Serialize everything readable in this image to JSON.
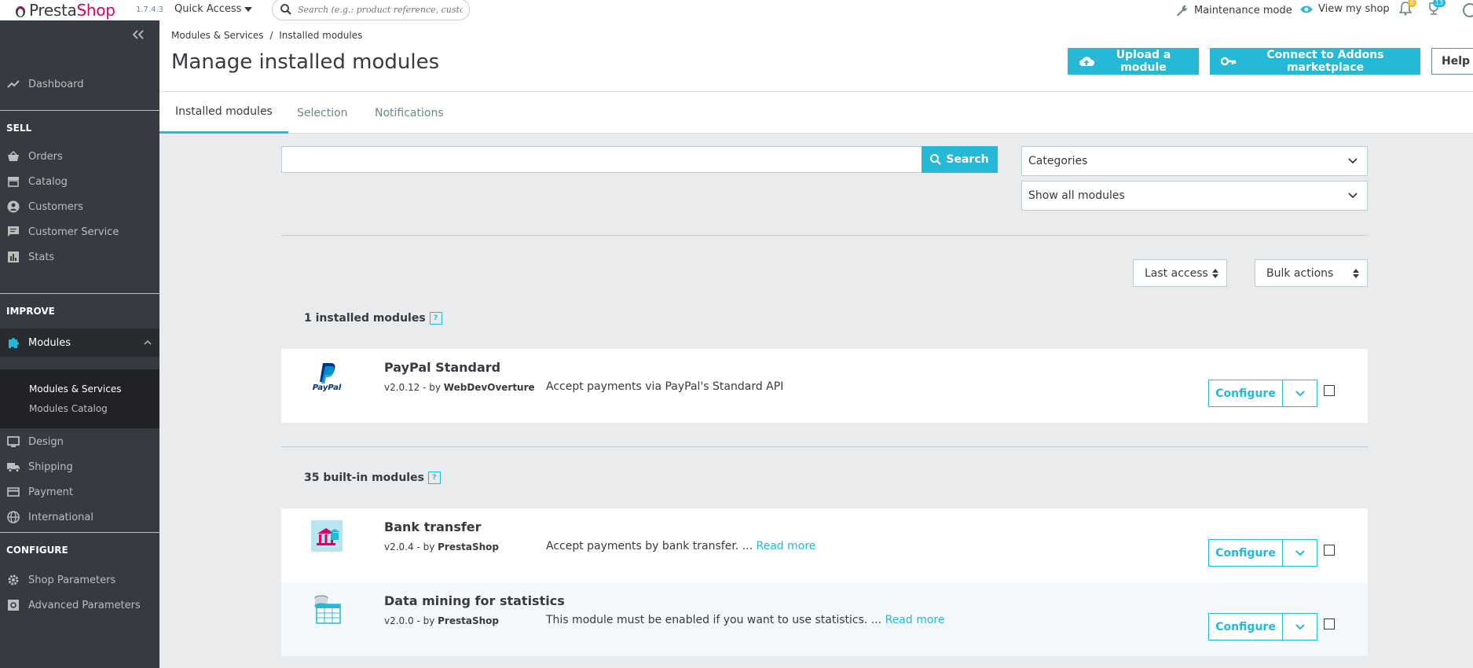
{
  "header": {
    "brand_prefix": "Presta",
    "brand_suffix": "Shop",
    "version": "1.7.4.3",
    "quick_access": "Quick Access",
    "search_placeholder": "Search (e.g.: product reference, custome",
    "maintenance": "Maintenance mode",
    "view_shop": "View my shop",
    "notif_count_1": "6",
    "notif_count_2": "13",
    "accent": "#25b9d7",
    "brand_color": "#df0067"
  },
  "sidebar": {
    "dashboard": "Dashboard",
    "sell": "SELL",
    "orders": "Orders",
    "catalog": "Catalog",
    "customers": "Customers",
    "customer_service": "Customer Service",
    "stats": "Stats",
    "improve": "IMPROVE",
    "modules": "Modules",
    "modules_services": "Modules & Services",
    "modules_catalog": "Modules Catalog",
    "design": "Design",
    "shipping": "Shipping",
    "payment": "Payment",
    "international": "International",
    "configure": "CONFIGURE",
    "shop_parameters": "Shop Parameters",
    "advanced_parameters": "Advanced Parameters"
  },
  "page": {
    "breadcrumb_parent": "Modules & Services",
    "breadcrumb_sep": "/",
    "breadcrumb_current": "Installed modules",
    "title": "Manage installed modules",
    "upload_btn": "Upload a module",
    "connect_btn": "Connect to Addons marketplace",
    "help_btn": "Help"
  },
  "tabs": {
    "installed": "Installed modules",
    "selection": "Selection",
    "notifications": "Notifications"
  },
  "filters": {
    "search_btn": "Search",
    "categories": "Categories",
    "status": "Show all modules",
    "sort": "Last access",
    "bulk": "Bulk actions"
  },
  "sections": {
    "installed_count": "1 installed modules",
    "builtin_count": "35 built-in modules",
    "help_mark": "?"
  },
  "modules": {
    "paypal": {
      "name": "PayPal Standard",
      "version": "v2.0.12 - by",
      "author": "WebDevOverture",
      "description": "Accept payments via PayPal's Standard API",
      "logo_text": "PayPal"
    },
    "bank": {
      "name": "Bank transfer",
      "version": "v2.0.4 - by",
      "author": "PrestaShop",
      "description": "Accept payments by bank transfer. ...",
      "read_more": "Read more"
    },
    "datamining": {
      "name": "Data mining for statistics",
      "version": "v2.0.0 - by",
      "author": "PrestaShop",
      "description": "This module must be enabled if you want to use statistics. ...",
      "read_more": "Read more"
    },
    "configure_label": "Configure"
  }
}
